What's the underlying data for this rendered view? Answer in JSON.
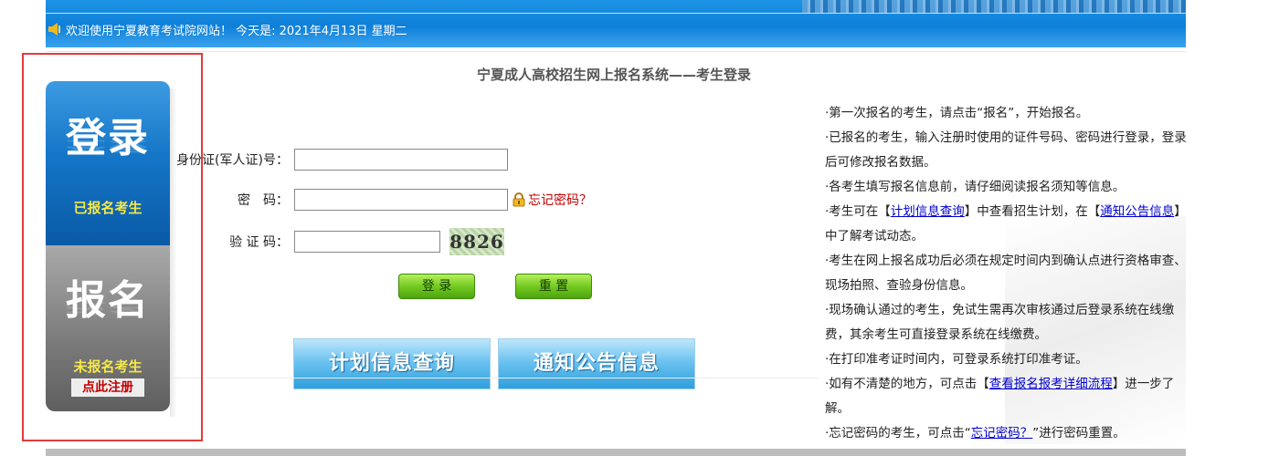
{
  "header": {
    "welcome_text": "欢迎使用宁夏教育考试院网站！ 今天是: 2021年4月13日 星期二"
  },
  "side": {
    "login_big": "登录",
    "login_sub": "已报名考生",
    "register_big": "报名",
    "register_sub": "未报名考生",
    "register_tag": "点此注册"
  },
  "form": {
    "title": "宁夏成人高校招生网上报名系统——考生登录",
    "id_label": "身份证(军人证)号：",
    "password_label": "密　码：",
    "captcha_label": "验 证 码：",
    "forgot_label": "忘记密码？",
    "captcha_value": "8826",
    "login_button": "登 录",
    "reset_button": "重 置",
    "plan_query_button": "计划信息查询",
    "notice_button": "通知公告信息"
  },
  "info": {
    "line1": "·第一次报名的考生，请点击“报名”，开始报名。",
    "line2": "·已报名的考生，输入注册时使用的证件号码、密码进行登录，登录后可修改报名数据。",
    "line3": "·各考生填写报名信息前，请仔细阅读报名须知等信息。",
    "line4_pre": "·考生可在【",
    "line4_link1": "计划信息查询",
    "line4_mid": "】中查看招生计划，在【",
    "line4_link2": "通知公告信息",
    "line4_post": "】中了解考试动态。",
    "line5": "·考生在网上报名成功后必须在规定时间内到确认点进行资格审查、现场拍照、查验身份信息。",
    "line6": "·现场确认通过的考生，免试生需再次审核通过后登录系统在线缴费，其余考生可直接登录系统在线缴费。",
    "line7": "·在打印准考证时间内，可登录系统打印准考证。",
    "line8_pre": "·如有不清楚的地方，可点击【",
    "line8_link": "查看报名报考详细流程",
    "line8_post": "】进一步了解。",
    "line9_pre": "·忘记密码的考生，可点击“",
    "line9_link": "忘记密码？",
    "line9_post": "”进行密码重置。"
  }
}
